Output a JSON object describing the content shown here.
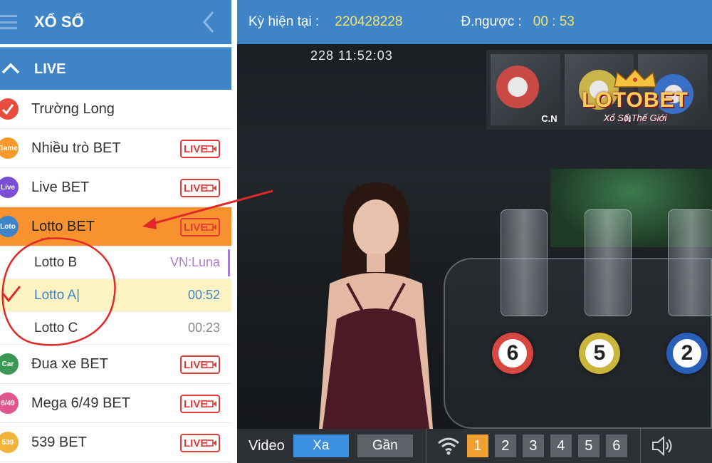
{
  "sidebar": {
    "title": "XỔ SỐ",
    "live_label": "LIVE",
    "items": [
      {
        "label": "Trường Long",
        "icon": "check-arrow-icon",
        "icon_text": "",
        "color": "#e84c3d",
        "badge": ""
      },
      {
        "label": "Nhiều trò BET",
        "icon": "game-icon",
        "icon_text": "Game",
        "color": "#f59a2b",
        "badge": "LIVE"
      },
      {
        "label": "Live BET",
        "icon": "live-icon",
        "icon_text": "Live",
        "color": "#7a4fd6",
        "badge": "LIVE"
      },
      {
        "label": "Lotto BET",
        "icon": "loto-icon",
        "icon_text": "Loto",
        "color": "#3f84c6",
        "badge": "LIVE"
      }
    ],
    "sub_items": [
      {
        "label": "Lotto B",
        "value": "VN:Luna"
      },
      {
        "label": "Lotto A|",
        "value": "00:52"
      },
      {
        "label": "Lotto C",
        "value": "00:23"
      }
    ],
    "items2": [
      {
        "label": "Đua xe BET",
        "icon": "car-icon",
        "icon_text": "Car",
        "color": "#3a9a55",
        "badge": "LIVE"
      },
      {
        "label": "Mega 6/49 BET",
        "icon": "mega-649-icon",
        "icon_text": "6/49",
        "color": "#e0568f",
        "badge": "LIVE"
      },
      {
        "label": "539 BET",
        "icon": "539-icon",
        "icon_text": "539",
        "color": "#f2b33a",
        "badge": "LIVE"
      }
    ]
  },
  "video": {
    "current_label": "Kỳ hiện tại  :",
    "current_value": "220428228",
    "countdown_label": "Đ.ngược  :",
    "countdown_value": "00 : 53",
    "timestamp": "228   11:52:03",
    "thumbs": [
      "C.N",
      "N",
      ""
    ],
    "logo_name": "LOTOBET",
    "logo_tagline": "Xổ Số Thế Giới",
    "balls": [
      "6",
      "5",
      "2"
    ],
    "ball_colors": [
      "#d8473f",
      "#c9b53a",
      "#2a5fb8"
    ],
    "bottom": {
      "video_label": "Video",
      "far_label": "Xa",
      "near_label": "Gần",
      "cameras": [
        "1",
        "2",
        "3",
        "4",
        "5",
        "6"
      ],
      "active_camera": "1"
    }
  },
  "colors": {
    "primary": "#3f84c6",
    "active_row": "#f7922f",
    "live_badge": "#e03c3c",
    "highlight": "#fdf2c2"
  }
}
